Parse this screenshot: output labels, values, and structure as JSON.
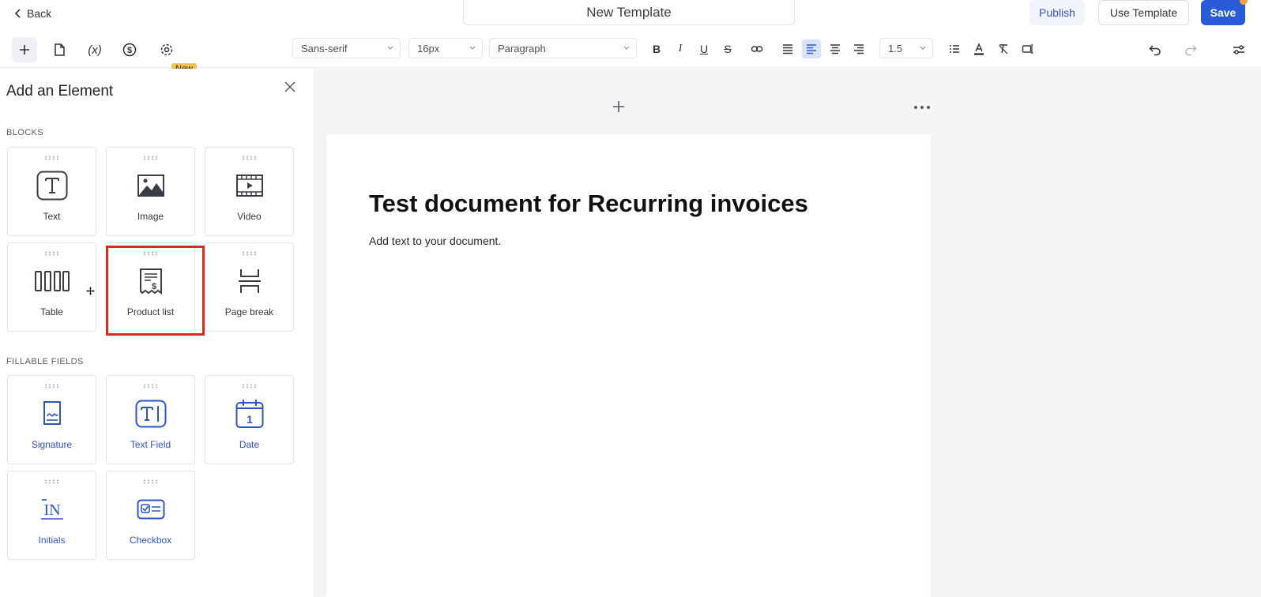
{
  "header": {
    "back_label": "Back",
    "template_name": "New Template",
    "publish_label": "Publish",
    "use_template_label": "Use Template",
    "save_label": "Save"
  },
  "toolbar": {
    "new_badge": "New",
    "variable_icon_text": "(x)",
    "font_family": "Sans-serif",
    "font_size": "16px",
    "block_style": "Paragraph",
    "line_height": "1.5",
    "bold": "B",
    "italic": "I",
    "underline": "U",
    "strike": "S"
  },
  "panel": {
    "title": "Add an Element",
    "blocks_heading": "BLOCKS",
    "blocks": [
      {
        "label": "Text",
        "icon": "text-block-icon"
      },
      {
        "label": "Image",
        "icon": "image-icon"
      },
      {
        "label": "Video",
        "icon": "video-icon"
      },
      {
        "label": "Table",
        "icon": "table-icon"
      },
      {
        "label": "Product list",
        "icon": "product-list-icon"
      },
      {
        "label": "Page break",
        "icon": "page-break-icon"
      }
    ],
    "fields_heading": "FILLABLE FIELDS",
    "fields": [
      {
        "label": "Signature",
        "icon": "signature-icon"
      },
      {
        "label": "Text Field",
        "icon": "text-field-icon"
      },
      {
        "label": "Date",
        "icon": "date-icon"
      },
      {
        "label": "Initials",
        "icon": "initials-icon"
      },
      {
        "label": "Checkbox",
        "icon": "checkbox-icon"
      }
    ],
    "date_icon_day": "1",
    "initials_icon_text": "IN"
  },
  "document": {
    "title": "Test document for Recurring invoices",
    "body": "Add text to your document."
  },
  "colors": {
    "accent": "#2a5bd7",
    "highlight": "#d92b1c",
    "badge": "#f2c14e",
    "field_icon": "#2f54c4"
  }
}
